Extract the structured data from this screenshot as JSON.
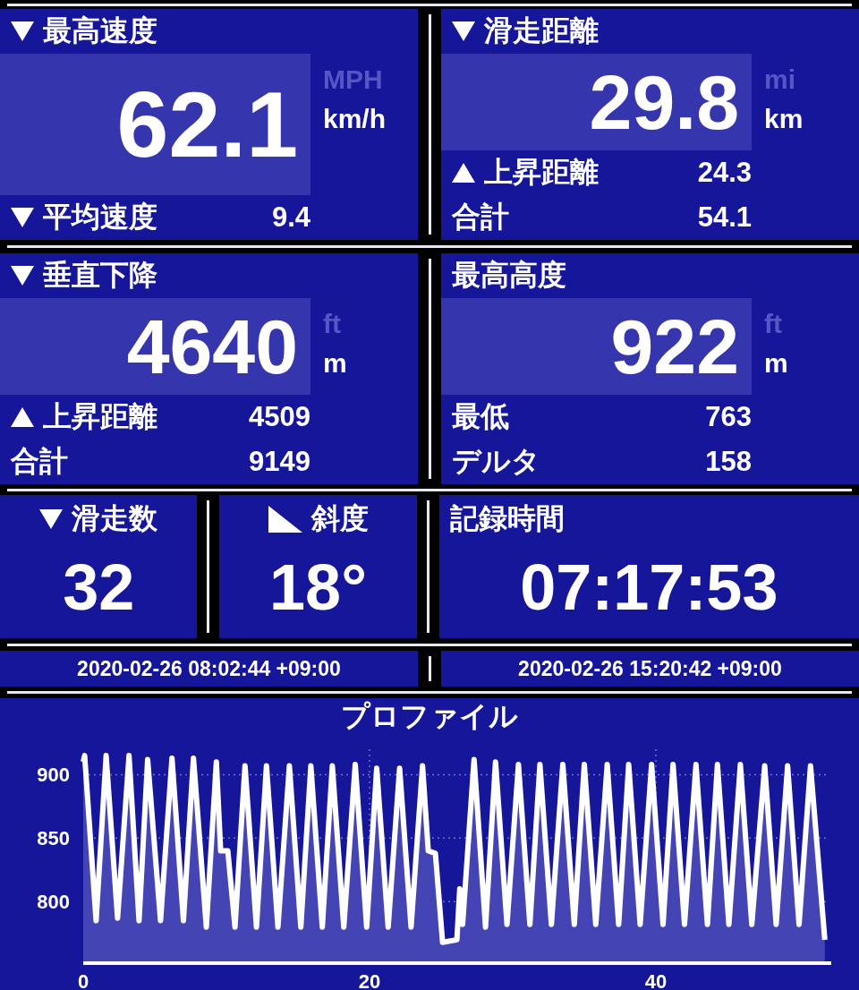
{
  "top_panels": [
    {
      "label": "最高速度",
      "kind": "down",
      "value": "62.1",
      "units": [
        {
          "text": "MPH",
          "selected": false
        },
        {
          "text": "km/h",
          "selected": true
        }
      ],
      "stats": [
        {
          "label": "平均速度",
          "kind": "down",
          "value": "9.4"
        }
      ]
    },
    {
      "label": "滑走距離",
      "kind": "down",
      "value": "29.8",
      "units": [
        {
          "text": "mi",
          "selected": false
        },
        {
          "text": "km",
          "selected": true
        }
      ],
      "stats": [
        {
          "label": "上昇距離",
          "kind": "up",
          "value": "24.3"
        },
        {
          "label": "合計",
          "kind": "plain",
          "value": "54.1"
        }
      ]
    },
    {
      "label": "垂直下降",
      "kind": "down",
      "value": "4640",
      "units": [
        {
          "text": "ft",
          "selected": false
        },
        {
          "text": "m",
          "selected": true
        }
      ],
      "stats": [
        {
          "label": "上昇距離",
          "kind": "up",
          "value": "4509"
        },
        {
          "label": "合計",
          "kind": "plain",
          "value": "9149"
        }
      ]
    },
    {
      "label": "最高高度",
      "kind": "plain",
      "value": "922",
      "units": [
        {
          "text": "ft",
          "selected": false
        },
        {
          "text": "m",
          "selected": true
        }
      ],
      "stats": [
        {
          "label": "最低",
          "kind": "plain",
          "value": "763"
        },
        {
          "label": "デルタ",
          "kind": "plain",
          "value": "158"
        }
      ]
    }
  ],
  "tiles": [
    {
      "label": "滑走数",
      "kind": "down",
      "value": "32"
    },
    {
      "label": "斜度",
      "kind": "slope",
      "value": "18°"
    }
  ],
  "record_time": {
    "label": "記録時間",
    "value": "07:17:53"
  },
  "time_range": [
    "2020-02-26 08:02:44 +09:00",
    "2020-02-26 15:20:42 +09:00"
  ],
  "profile": {
    "title": "プロファイル",
    "chart_data": {
      "type": "area",
      "grid": true,
      "xlim": [
        0,
        52
      ],
      "ylim": [
        753,
        920
      ],
      "xticks": [
        0,
        20,
        40
      ],
      "yticks": [
        800,
        850,
        900
      ],
      "x": [
        0,
        0.1,
        0.9,
        1.6,
        2.4,
        3.2,
        3.9,
        4.5,
        5.4,
        6.2,
        7.0,
        7.7,
        8.6,
        9.3,
        9.6,
        10.1,
        10.6,
        11.3,
        12.1,
        12.8,
        13.6,
        14.4,
        15.2,
        15.9,
        16.7,
        17.4,
        18.2,
        19.0,
        19.8,
        20.5,
        21.3,
        22.1,
        22.9,
        23.7,
        24.1,
        24.6,
        25.1,
        26.1,
        26.3,
        26.5,
        27.3,
        28.1,
        28.8,
        29.6,
        30.4,
        31.2,
        31.9,
        32.7,
        33.5,
        34.3,
        35.0,
        35.8,
        36.6,
        37.4,
        38.1,
        38.9,
        39.7,
        40.5,
        41.2,
        42.0,
        42.8,
        43.6,
        44.3,
        45.1,
        45.9,
        46.7,
        47.6,
        48.4,
        49.2,
        50.0,
        50.8,
        51.8
      ],
      "series": [
        {
          "color": "#ffffff",
          "values": [
            910,
            915,
            785,
            915,
            787,
            915,
            785,
            912,
            785,
            913,
            785,
            913,
            780,
            910,
            840,
            840,
            780,
            907,
            780,
            907,
            780,
            907,
            780,
            907,
            780,
            907,
            780,
            908,
            780,
            905,
            780,
            905,
            780,
            907,
            840,
            838,
            768,
            770,
            810,
            782,
            912,
            780,
            910,
            782,
            908,
            782,
            908,
            782,
            908,
            782,
            908,
            782,
            908,
            782,
            908,
            782,
            908,
            782,
            908,
            782,
            908,
            782,
            908,
            782,
            908,
            782,
            907,
            782,
            907,
            782,
            907,
            770
          ]
        }
      ]
    }
  }
}
